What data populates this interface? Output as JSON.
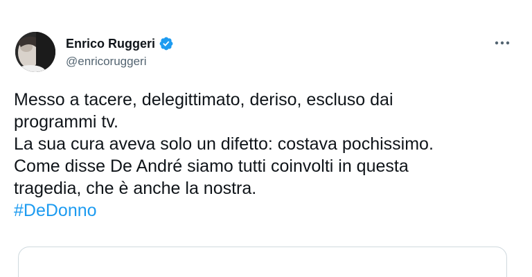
{
  "author": {
    "display_name": "Enrico Ruggeri",
    "handle": "@enricoruggeri",
    "verified": true,
    "avatar_icon": "profile-photo"
  },
  "tweet": {
    "lines": [
      "Messo a tacere, delegittimato, deriso, escluso dai",
      "programmi tv.",
      "La sua cura aveva solo un difetto: costava pochissimo.",
      "Come disse De André siamo tutti coinvolti in questa",
      "tragedia, che è anche la nostra."
    ],
    "hashtag": "#DeDonno"
  },
  "icons": {
    "more": "more-options-icon",
    "verified": "verified-badge-icon"
  },
  "colors": {
    "text": "#0f1419",
    "secondary": "#536471",
    "accent": "#1d9bf0",
    "border": "#cfd9de"
  }
}
